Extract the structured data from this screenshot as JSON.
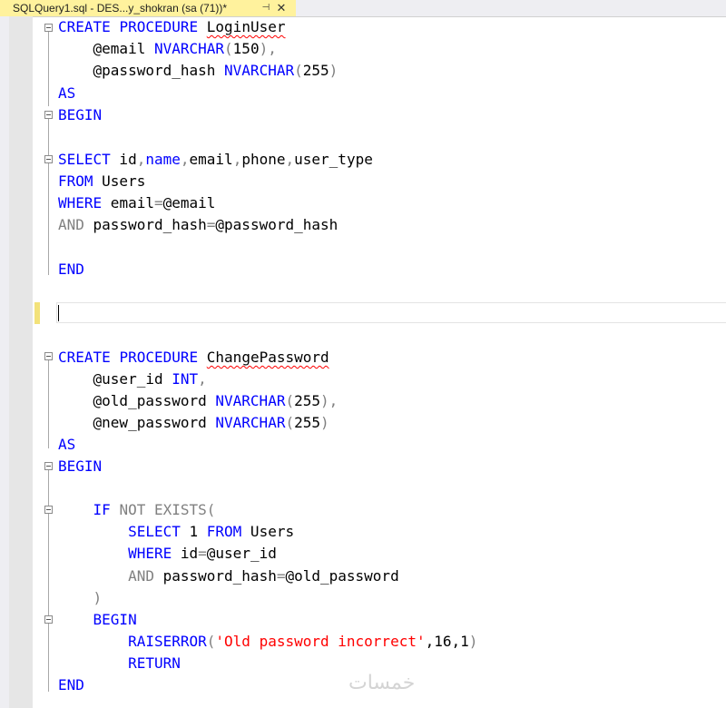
{
  "tab": {
    "title": "SQLQuery1.sql - DES...y_shokran (sa (71))*",
    "pin_glyph": "⊣",
    "close_glyph": "✕"
  },
  "watermark": "خمسات",
  "code": {
    "l1": [
      "CREATE",
      " ",
      "PROCEDURE",
      " ",
      "LoginUser"
    ],
    "l2": [
      "    @email ",
      "NVARCHAR",
      "(",
      "150",
      "),"
    ],
    "l3": [
      "    @password_hash ",
      "NVARCHAR",
      "(",
      "255",
      ")"
    ],
    "l4": [
      "AS"
    ],
    "l5": [
      "BEGIN"
    ],
    "l6": [
      "SELECT",
      " id",
      ",",
      "name",
      ",",
      "email",
      ",",
      "phone",
      ",",
      "user_type"
    ],
    "l7": [
      "FROM",
      " Users"
    ],
    "l8": [
      "WHERE",
      " email",
      "=",
      "@email"
    ],
    "l9": [
      "AND",
      " password_hash",
      "=",
      "@password_hash"
    ],
    "l10": [
      "END"
    ],
    "l11": [
      "CREATE",
      " ",
      "PROCEDURE",
      " ",
      "ChangePassword"
    ],
    "l12": [
      "    @user_id ",
      "INT",
      ","
    ],
    "l13": [
      "    @old_password ",
      "NVARCHAR",
      "(",
      "255",
      "),"
    ],
    "l14": [
      "    @new_password ",
      "NVARCHAR",
      "(",
      "255",
      ")"
    ],
    "l15": [
      "AS"
    ],
    "l16": [
      "BEGIN"
    ],
    "l17": [
      "    ",
      "IF",
      " ",
      "NOT",
      " ",
      "EXISTS",
      "("
    ],
    "l18": [
      "        ",
      "SELECT",
      " 1 ",
      "FROM",
      " Users"
    ],
    "l19": [
      "        ",
      "WHERE",
      " id",
      "=",
      "@user_id"
    ],
    "l20": [
      "        ",
      "AND",
      " password_hash",
      "=",
      "@old_password"
    ],
    "l21": [
      "    ",
      ")"
    ],
    "l22": [
      "    ",
      "BEGIN"
    ],
    "l23": [
      "        ",
      "RAISERROR",
      "(",
      "'Old password incorrect'",
      ",16,1",
      ")"
    ],
    "l24": [
      "        ",
      "RETURN"
    ],
    "l25": [
      "END"
    ]
  }
}
